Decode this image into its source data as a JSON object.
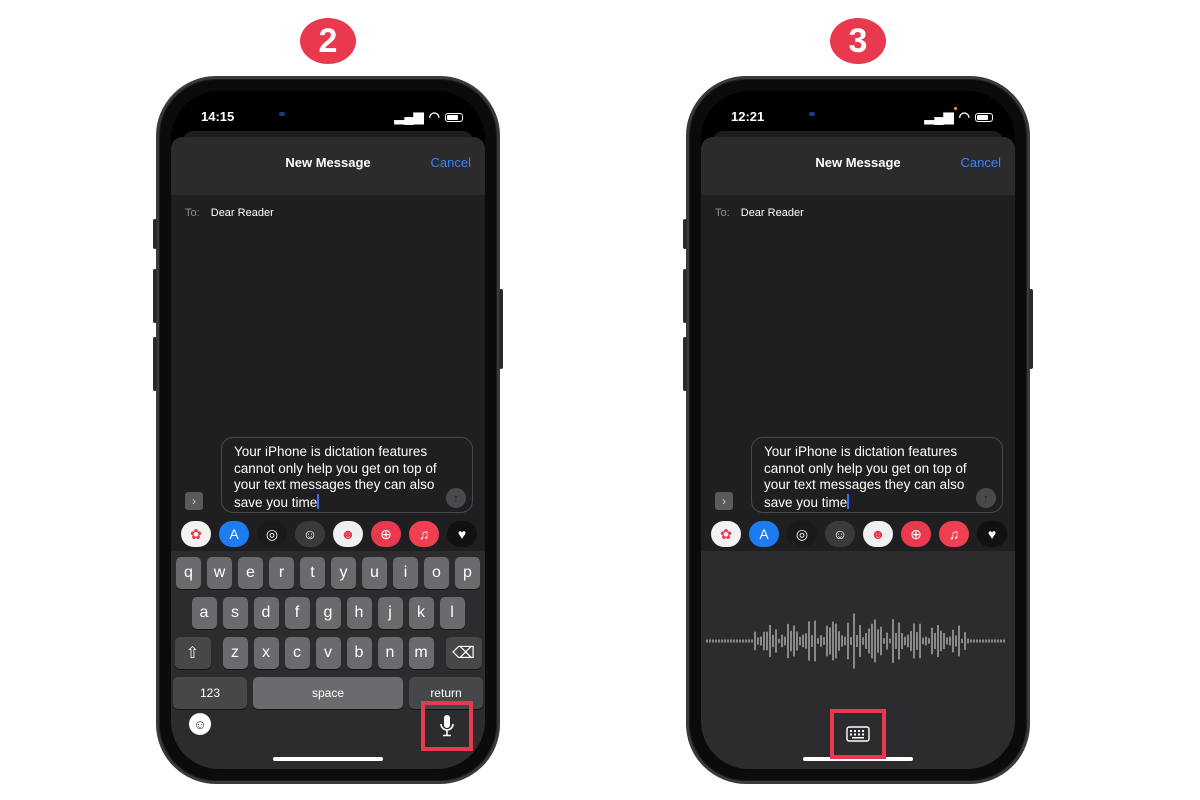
{
  "steps": [
    {
      "badge": "2",
      "status": {
        "time": "14:15"
      },
      "header": {
        "title": "New Message",
        "cancel": "Cancel"
      },
      "to": {
        "label": "To:",
        "value": "Dear Reader"
      },
      "message": {
        "text": "Your iPhone is dictation features cannot only help you get on top of your text messages they can also save you time"
      },
      "keyboard": {
        "row1": [
          "q",
          "w",
          "e",
          "r",
          "t",
          "y",
          "u",
          "i",
          "o",
          "p"
        ],
        "row2": [
          "a",
          "s",
          "d",
          "f",
          "g",
          "h",
          "j",
          "k",
          "l"
        ],
        "row3": [
          "z",
          "x",
          "c",
          "v",
          "b",
          "n",
          "m"
        ],
        "numbers": "123",
        "space": "space",
        "return": "return"
      },
      "highlighted_button": "microphone"
    },
    {
      "badge": "3",
      "status": {
        "time": "12:21"
      },
      "header": {
        "title": "New Message",
        "cancel": "Cancel"
      },
      "to": {
        "label": "To:",
        "value": "Dear Reader"
      },
      "message": {
        "text": "Your iPhone is dictation features cannot only help you get on top of your text messages they can also save you time"
      },
      "dictation": {
        "state": "listening"
      },
      "highlighted_button": "keyboard"
    }
  ],
  "apps": [
    {
      "name": "photos",
      "glyph": "✿",
      "color": "#f2f2f2"
    },
    {
      "name": "app-store",
      "glyph": "A",
      "color": "#1e7cf2"
    },
    {
      "name": "activity",
      "glyph": "◎",
      "color": "#1a1a1a"
    },
    {
      "name": "memoji",
      "glyph": "☺",
      "color": "#3a3a3a"
    },
    {
      "name": "animoji",
      "glyph": "☻",
      "color": "#f0f0f0"
    },
    {
      "name": "search-images",
      "glyph": "⊕",
      "color": "#e8394f"
    },
    {
      "name": "music",
      "glyph": "♫",
      "color": "#f0404f"
    },
    {
      "name": "digital-touch",
      "glyph": "♥",
      "color": "#111111"
    }
  ],
  "colors": {
    "accent": "#e8394f",
    "link": "#3a82f7"
  }
}
